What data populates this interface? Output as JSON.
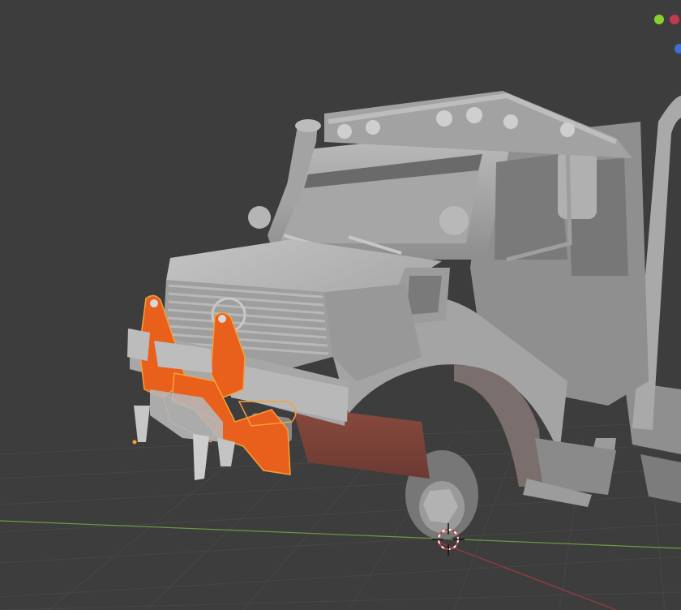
{
  "viewport": {
    "background": "#3d3d3d",
    "grid_color": "#4a4a4a",
    "x_axis_color": "#c33a50",
    "y_axis_color": "#7fb14a"
  },
  "model": {
    "body_color": "#9a9a9a",
    "body_light": "#b3b3b3",
    "body_dark": "#5f5f5f",
    "selection_color": "#e8601c",
    "selection_outline": "#f6a03a"
  },
  "gizmo": {
    "x_color": "#c33a50",
    "y_color": "#8bd12c",
    "z_color": "#3b6fd1"
  },
  "cursor": {
    "icon": "crosshair-3d-cursor-icon"
  }
}
